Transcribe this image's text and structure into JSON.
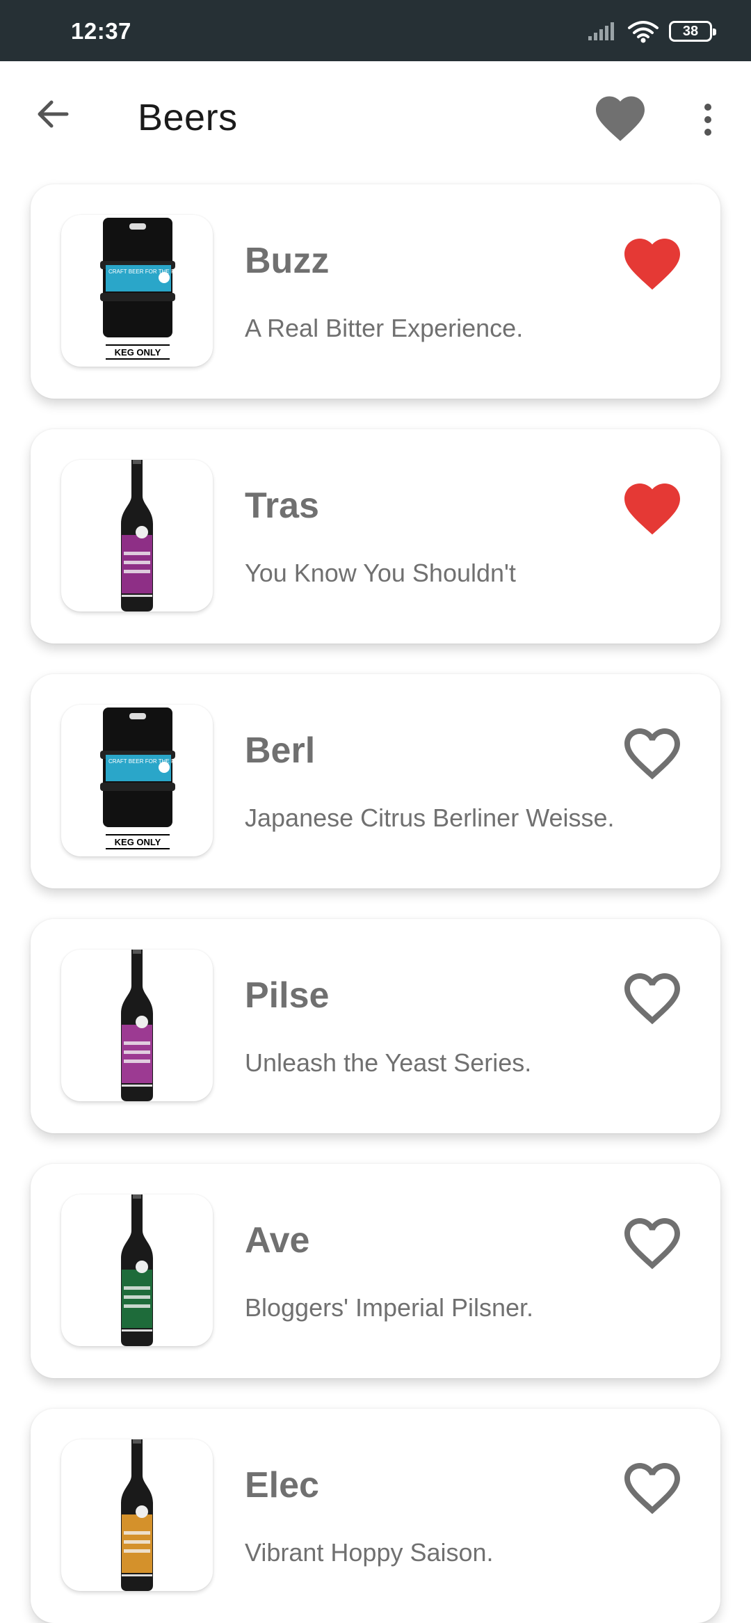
{
  "status_bar": {
    "time": "12:37",
    "battery_level": "38"
  },
  "app_bar": {
    "title": "Beers",
    "back_icon": "arrow-back-icon",
    "favorites_icon": "heart-filled-icon",
    "menu_icon": "more-vert-icon"
  },
  "colors": {
    "favorite_active": "#E53935",
    "icon_gray": "#707070",
    "status_bar_bg": "#263035"
  },
  "beers": [
    {
      "name": "Buzz",
      "tagline": "A Real Bitter Experience.",
      "favorite": true,
      "image": "keg",
      "keg_label": "KEG ONLY",
      "keg_banner": "CRAFT BEER FOR THE PEOPLE"
    },
    {
      "name": "Tras",
      "tagline": "You Know You Shouldn't",
      "favorite": true,
      "image": "bottle",
      "label_color": "#8E2F86"
    },
    {
      "name": "Berl",
      "tagline": "Japanese Citrus Berliner Weisse.",
      "favorite": false,
      "image": "keg",
      "keg_label": "KEG ONLY",
      "keg_banner": "CRAFT BEER FOR THE PEOPLE"
    },
    {
      "name": "Pilse",
      "tagline": "Unleash the Yeast Series.",
      "favorite": false,
      "image": "bottle",
      "label_color": "#9C3A92"
    },
    {
      "name": "Ave",
      "tagline": "Bloggers' Imperial Pilsner.",
      "favorite": false,
      "image": "bottle",
      "label_color": "#1E6B3A"
    },
    {
      "name": "Elec",
      "tagline": "Vibrant Hoppy Saison.",
      "favorite": false,
      "image": "bottle",
      "label_color": "#D4912B"
    }
  ]
}
